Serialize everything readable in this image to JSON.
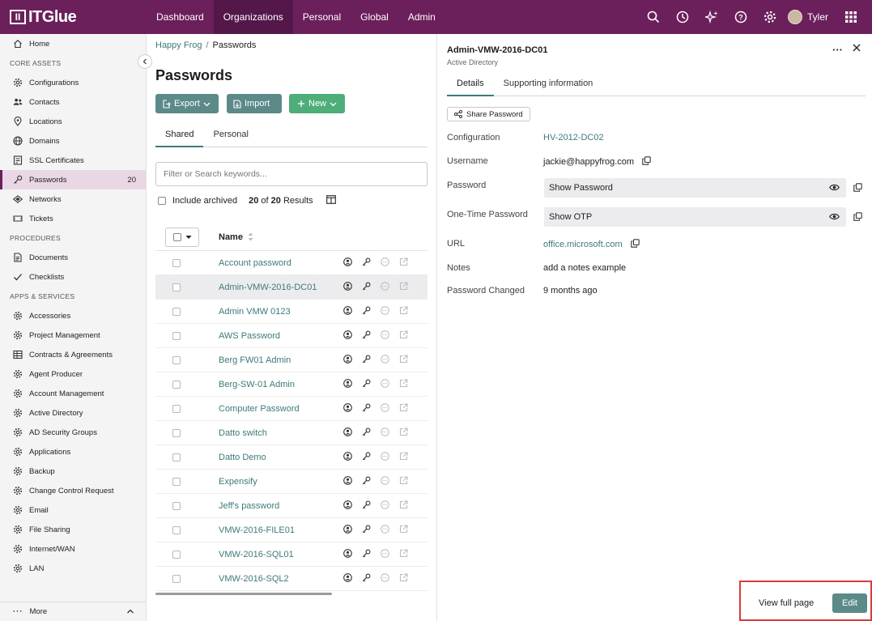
{
  "brand": {
    "logo_text": "ITGlue",
    "accent": "#6b1f5b",
    "link_color": "#3d7a78"
  },
  "topnav": {
    "items": [
      "Dashboard",
      "Organizations",
      "Personal",
      "Global",
      "Admin"
    ],
    "active": "Organizations",
    "user": "Tyler",
    "icons": [
      "search-icon",
      "history-icon",
      "sparkle-icon",
      "help-icon",
      "settings-icon",
      "apps-grid-icon"
    ]
  },
  "sidebar": {
    "home": "Home",
    "sections": [
      {
        "title": "CORE ASSETS",
        "items": [
          {
            "label": "Configurations",
            "icon": "gear-icon"
          },
          {
            "label": "Contacts",
            "icon": "contacts-icon"
          },
          {
            "label": "Locations",
            "icon": "location-pin-icon"
          },
          {
            "label": "Domains",
            "icon": "globe-icon"
          },
          {
            "label": "SSL Certificates",
            "icon": "certificate-icon"
          },
          {
            "label": "Passwords",
            "icon": "key-icon",
            "count": "20",
            "active": true
          },
          {
            "label": "Networks",
            "icon": "network-icon"
          },
          {
            "label": "Tickets",
            "icon": "ticket-icon"
          }
        ]
      },
      {
        "title": "PROCEDURES",
        "items": [
          {
            "label": "Documents",
            "icon": "document-icon"
          },
          {
            "label": "Checklists",
            "icon": "checkmark-icon"
          }
        ]
      },
      {
        "title": "APPS & SERVICES",
        "items": [
          {
            "label": "Accessories",
            "icon": "gear-icon"
          },
          {
            "label": "Project Management",
            "icon": "gear-icon"
          },
          {
            "label": "Contracts & Agreements",
            "icon": "table-icon"
          },
          {
            "label": "Agent Producer",
            "icon": "gear-icon"
          },
          {
            "label": "Account Management",
            "icon": "gear-icon"
          },
          {
            "label": "Active Directory",
            "icon": "gear-icon"
          },
          {
            "label": "AD Security Groups",
            "icon": "gear-icon"
          },
          {
            "label": "Applications",
            "icon": "gear-icon"
          },
          {
            "label": "Backup",
            "icon": "gear-icon"
          },
          {
            "label": "Change Control Request",
            "icon": "gear-icon"
          },
          {
            "label": "Email",
            "icon": "gear-icon"
          },
          {
            "label": "File Sharing",
            "icon": "gear-icon"
          },
          {
            "label": "Internet/WAN",
            "icon": "gear-icon"
          },
          {
            "label": "LAN",
            "icon": "gear-icon"
          }
        ]
      }
    ],
    "more": "More"
  },
  "main": {
    "breadcrumb": {
      "org": "Happy Frog",
      "sep": "/",
      "current": "Passwords"
    },
    "title": "Passwords",
    "buttons": {
      "export": "Export",
      "import": "Import",
      "new": "New"
    },
    "tabs": [
      "Shared",
      "Personal"
    ],
    "search_placeholder": "Filter or Search keywords...",
    "include_archived": "Include archived",
    "results": {
      "shown": "20",
      "of": "of",
      "total": "20",
      "label": "Results"
    },
    "column_name": "Name",
    "rows": [
      "Account password",
      "Admin-VMW-2016-DC01",
      "Admin VMW 0123",
      "AWS Password",
      "Berg FW01 Admin",
      "Berg-SW-01 Admin",
      "Computer Password",
      "Datto switch",
      "Datto Demo",
      "Expensify",
      "Jeff's password",
      "VMW-2016-FILE01",
      "VMW-2016-SQL01",
      "VMW-2016-SQL2"
    ],
    "selected_row": "Admin-VMW-2016-DC01"
  },
  "detail": {
    "title": "Admin-VMW-2016-DC01",
    "subtitle": "Active Directory",
    "tabs": [
      "Details",
      "Supporting information"
    ],
    "share_button": "Share Password",
    "fields": {
      "configuration": {
        "label": "Configuration",
        "value": "HV-2012-DC02"
      },
      "username": {
        "label": "Username",
        "value": "jackie@happyfrog.com"
      },
      "password": {
        "label": "Password",
        "value": "Show Password"
      },
      "otp": {
        "label": "One-Time Password",
        "value": "Show OTP"
      },
      "url": {
        "label": "URL",
        "value": "office.microsoft.com"
      },
      "notes": {
        "label": "Notes",
        "value": "add a notes example"
      },
      "changed": {
        "label": "Password Changed",
        "value": "9 months ago"
      }
    },
    "footer": {
      "view_full_page": "View full page",
      "edit": "Edit"
    }
  }
}
